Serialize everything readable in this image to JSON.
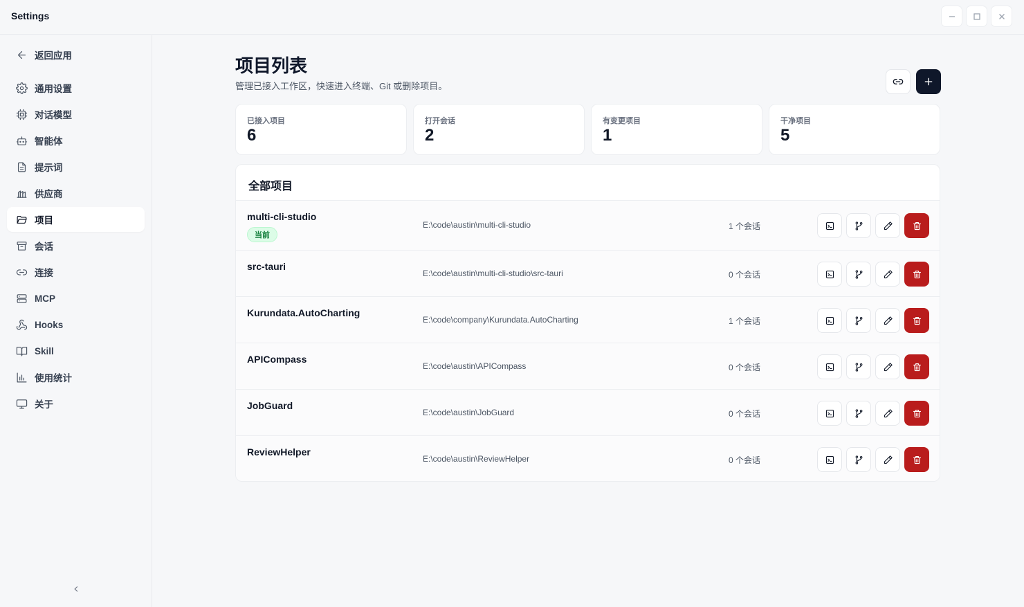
{
  "window": {
    "title": "Settings"
  },
  "sidebar": {
    "back_label": "返回应用",
    "items": [
      {
        "label": "通用设置",
        "icon": "gear-icon"
      },
      {
        "label": "对话模型",
        "icon": "cpu-icon"
      },
      {
        "label": "智能体",
        "icon": "bot-icon"
      },
      {
        "label": "提示词",
        "icon": "document-icon"
      },
      {
        "label": "供应商",
        "icon": "bar-chart-icon"
      },
      {
        "label": "项目",
        "icon": "folder-icon",
        "active": true
      },
      {
        "label": "会话",
        "icon": "archive-icon"
      },
      {
        "label": "连接",
        "icon": "link-icon"
      },
      {
        "label": "MCP",
        "icon": "server-icon"
      },
      {
        "label": "Hooks",
        "icon": "webhook-icon"
      },
      {
        "label": "Skill",
        "icon": "book-icon"
      },
      {
        "label": "使用统计",
        "icon": "chart-icon"
      },
      {
        "label": "关于",
        "icon": "monitor-icon"
      }
    ]
  },
  "header": {
    "title": "项目列表",
    "subtitle": "管理已接入工作区，快速进入终端、Git 或删除项目。"
  },
  "stats": [
    {
      "label": "已接入项目",
      "value": "6"
    },
    {
      "label": "打开会话",
      "value": "2"
    },
    {
      "label": "有变更项目",
      "value": "1"
    },
    {
      "label": "干净项目",
      "value": "5"
    }
  ],
  "projects": {
    "title": "全部项目",
    "current_badge": "当前",
    "rows": [
      {
        "name": "multi-cli-studio",
        "path": "E:\\code\\austin\\multi-cli-studio",
        "sessions": "1 个会话",
        "current": true
      },
      {
        "name": "src-tauri",
        "path": "E:\\code\\austin\\multi-cli-studio\\src-tauri",
        "sessions": "0 个会话",
        "current": false
      },
      {
        "name": "Kurundata.AutoCharting",
        "path": "E:\\code\\company\\Kurundata.AutoCharting",
        "sessions": "1 个会话",
        "current": false
      },
      {
        "name": "APICompass",
        "path": "E:\\code\\austin\\APICompass",
        "sessions": "0 个会话",
        "current": false
      },
      {
        "name": "JobGuard",
        "path": "E:\\code\\austin\\JobGuard",
        "sessions": "0 个会话",
        "current": false
      },
      {
        "name": "ReviewHelper",
        "path": "E:\\code\\austin\\ReviewHelper",
        "sessions": "0 个会话",
        "current": false
      }
    ]
  },
  "colors": {
    "accent": "#0f172a",
    "danger": "#b91c1c",
    "badge_bg": "#dcfce7",
    "badge_text": "#15803d"
  }
}
